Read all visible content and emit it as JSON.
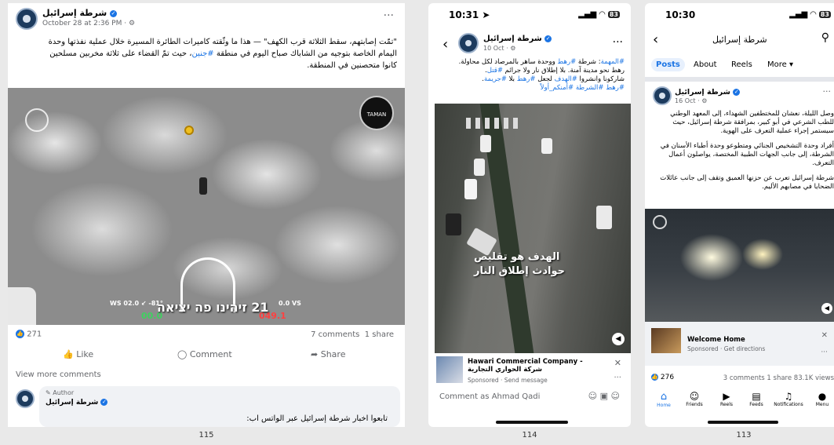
{
  "captions": [
    "115",
    "114",
    "113"
  ],
  "p1": {
    "page_name": "شرطة إسرائيل",
    "time": "October 28 at 2:36 PM · ",
    "post_text_1": "\"تمّت إصابتهم، سقط الثلاثة قرب الكهف\" — هذا ما وثّقته كاميرات الطائرة المسيرة خلال عملية نفذتها وحدة",
    "post_text_2a": "اليمام الخاصة بتوجيه من الشاباك صباح اليوم في منطقة ",
    "post_hashtag": "#جنين",
    "post_text_2b": "، حيث تمّ القضاء على ثلاثة مخربين مسلحين",
    "post_text_3": "كانوا متحصنين في المنطقة.",
    "overlay_text": "21 זיהינו פה יציאה",
    "hud_left": "WS 02.0 ↙ -81°",
    "hud_right": "0.0 VS",
    "hud_bottom_left": "00.0",
    "hud_bottom_right": "049.1",
    "unit_badge": "TAMAN",
    "reactions_count": "271",
    "comments_count": "7 comments",
    "shares_count": "1 share",
    "like_label": "Like",
    "comment_label": "Comment",
    "share_label": "Share",
    "view_more": "View more comments",
    "author_tag": "Author",
    "comment_author": "شرطة إسرائيل",
    "comment_text": "تابعوا اخبار شرطة إسرائيل عبر الواتس اب:"
  },
  "p2": {
    "clock": "10:31",
    "battery": "83",
    "page_name": "شرطة إسرائيل",
    "date": "10 Oct · ",
    "line1a": "#المهمة",
    "line1b": ": شرطة ",
    "line1c": "#رهط",
    "line1d": " ووحدة ساهر بالمرصاد لكل محاولة.",
    "line2a": "رهط نحو مدينة آمنة. بلا إطلاق نار ولا جرائم ",
    "line2b": "#قتل",
    "line2c": ".",
    "line3a": "شاركونا وانشروا ",
    "line3b": "#الهدف",
    "line3c": " لجعل ",
    "line3d": "#رهط",
    "line3e": " بلا ",
    "line3f": "#جريمة",
    "line3g": ".",
    "line4": "#رهط #الشرطة #أمنكم_أولاً",
    "video_overlay_1": "الهدف هو تقليص",
    "video_overlay_2": "حوادث إطلاق النار",
    "ad_title": "Hawari Commercial Company - شركة الحواري التجارية",
    "ad_sub": "Sponsored · Send message",
    "comment_placeholder": "Comment as Ahmad Qadi"
  },
  "p3": {
    "clock": "10:30",
    "battery": "83",
    "header_title": "شرطة إسرائيل",
    "tabs": [
      "Posts",
      "About",
      "Reels",
      "More ▾"
    ],
    "page_name": "شرطة إسرائيل",
    "date": "16 Oct · ",
    "para1_l1": "وصل الليلة، نعشان للمختطفين الشهداء، إلى المعهد الوطني",
    "para1_l2": "للطب الشرعي في أبو كبير، بمرافقة شرطة إسرائيل، حيث",
    "para1_l3": "سيستمر إجراء عملية التعرف على الهوية.",
    "para2_l1": "أفراد وحدة التشخيص الجنائي ومتطوعو وحدة أطباء الأسنان في",
    "para2_l2": "الشرطة، إلى جانب الجهات الطبية المختصة، يواصلون أعمال",
    "para2_l3": "التعرف.",
    "para3_l1": "شرطة إسرائيل تعرب عن حزنها العميق وتقف إلى جانب عائلات",
    "para3_l2": "الضحايا في مصابهم الأليم.",
    "ad_title": "Welcome Home",
    "ad_sub": "Sponsored · Get directions",
    "reactions": "276",
    "stats": "3 comments  1 share  83.1K views",
    "nav": [
      "Home",
      "Friends",
      "Reels",
      "Feeds",
      "Notifications",
      "Menu"
    ]
  }
}
